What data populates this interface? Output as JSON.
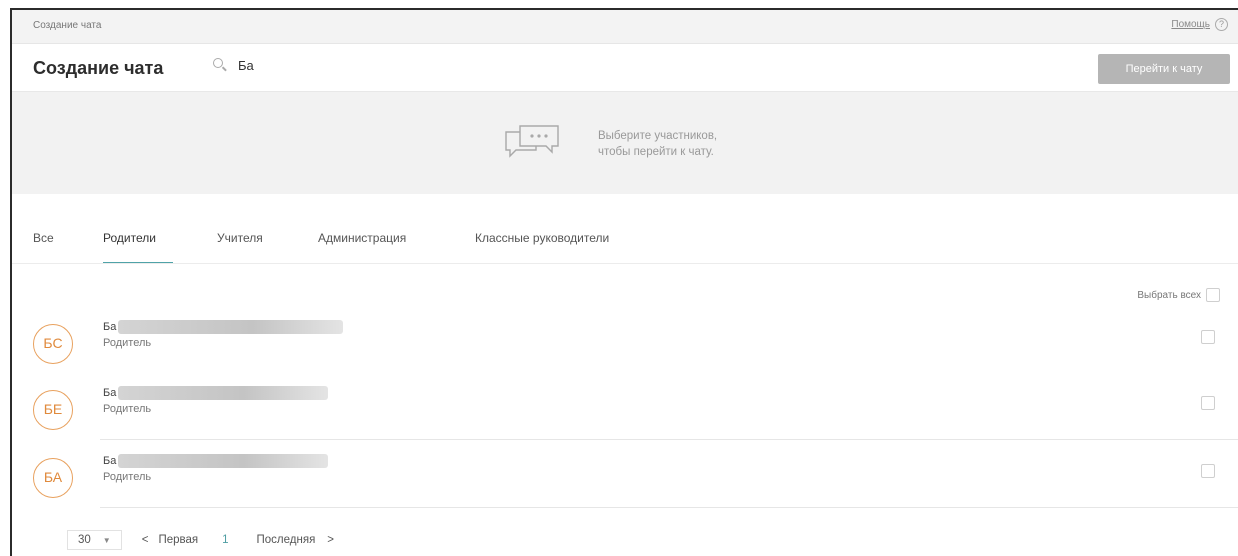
{
  "breadcrumb": "Создание чата",
  "help": {
    "label": "Помощь",
    "icon": "?"
  },
  "header": {
    "title": "Создание чата",
    "search_value": "Ба",
    "goto_button": "Перейти к чату"
  },
  "banner": {
    "line1": "Выберите участников,",
    "line2": "чтобы перейти к чату.",
    "icon": "chat-bubbles-icon"
  },
  "tabs": [
    {
      "label": "Все",
      "active": false
    },
    {
      "label": "Родители",
      "active": true
    },
    {
      "label": "Учителя",
      "active": false
    },
    {
      "label": "Администрация",
      "active": false
    },
    {
      "label": "Классные руководители",
      "active": false
    }
  ],
  "select_all": "Выбрать всех",
  "people": [
    {
      "initials": "БС",
      "name": "Ба",
      "role": "Родитель"
    },
    {
      "initials": "БЕ",
      "name": "Ба",
      "role": "Родитель"
    },
    {
      "initials": "БА",
      "name": "Ба",
      "role": "Родитель"
    }
  ],
  "pagination": {
    "per_page": "30",
    "prev": "<",
    "first": "Первая",
    "current": "1",
    "last": "Последняя",
    "next": ">"
  },
  "colors": {
    "accent": "#4fa3a8",
    "avatar": "#e08a3c",
    "button_disabled": "#b5b5b5",
    "banner_bg": "#f2f2f2"
  }
}
